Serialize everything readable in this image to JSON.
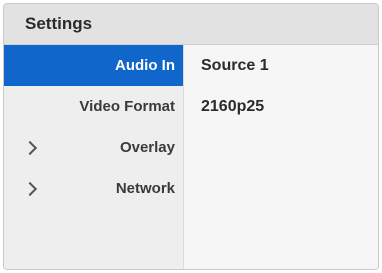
{
  "header": {
    "title": "Settings"
  },
  "sidebar": {
    "items": [
      {
        "label": "Audio In",
        "active": true,
        "expandable": false
      },
      {
        "label": "Video Format",
        "active": false,
        "expandable": false
      },
      {
        "label": "Overlay",
        "active": false,
        "expandable": true
      },
      {
        "label": "Network",
        "active": false,
        "expandable": true
      }
    ]
  },
  "content": {
    "values": [
      "Source 1",
      "2160p25"
    ]
  },
  "colors": {
    "accent": "#1166cc",
    "header_bg": "#e2e2e2",
    "sidebar_bg": "#eeeeee"
  },
  "icons": {
    "expand": "chevron-right-icon"
  }
}
